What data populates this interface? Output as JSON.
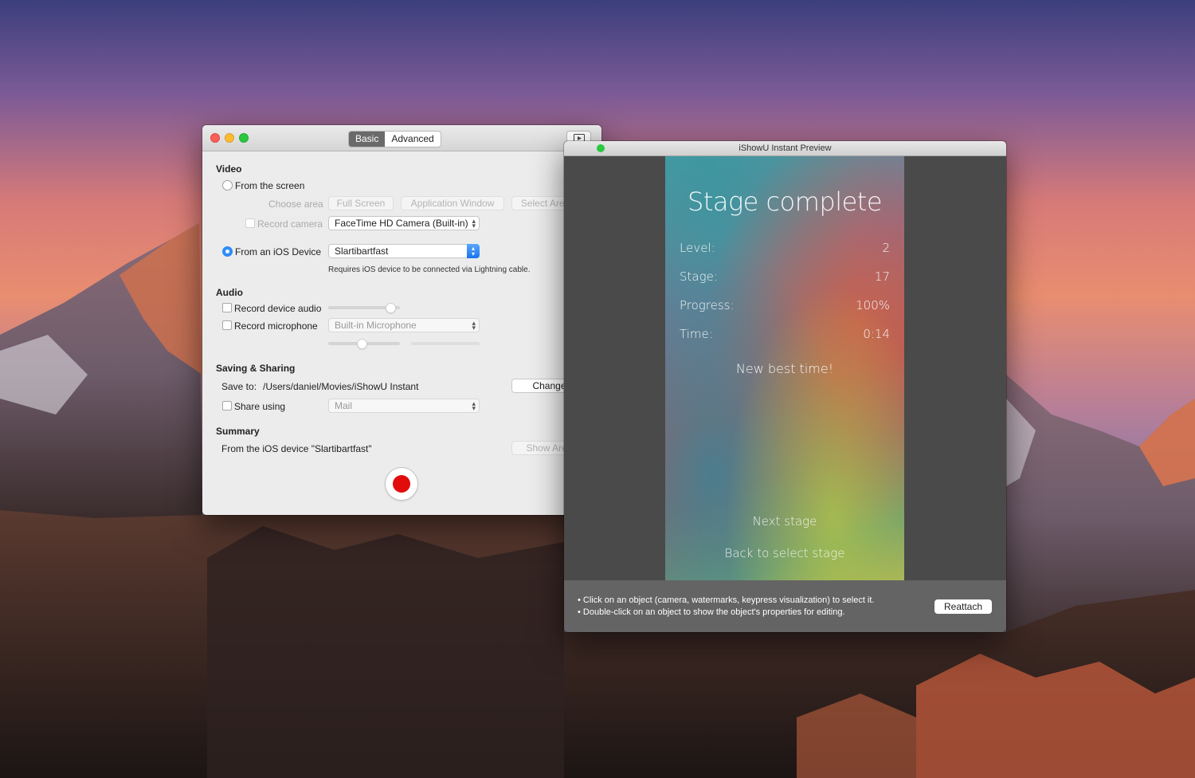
{
  "main_window": {
    "tabs": [
      {
        "label": "Basic",
        "active": true
      },
      {
        "label": "Advanced",
        "active": false
      }
    ],
    "video": {
      "section_title": "Video",
      "from_screen_label": "From the screen",
      "choose_area_label": "Choose area",
      "full_screen_label": "Full Screen",
      "application_window_label": "Application Window",
      "select_area_label": "Select Area...",
      "record_camera_label": "Record camera",
      "camera_value": "FaceTime HD Camera (Built-in)",
      "from_ios_label": "From an iOS Device",
      "ios_device_value": "Slartibartfast",
      "ios_note": "Requires iOS device to be connected via Lightning cable."
    },
    "audio": {
      "section_title": "Audio",
      "record_device_audio_label": "Record device audio",
      "device_audio_level": 0.87,
      "record_microphone_label": "Record microphone",
      "microphone_value": "Built-in Microphone",
      "microphone_level": 0.47
    },
    "saving": {
      "section_title": "Saving & Sharing",
      "save_to_label": "Save to:",
      "save_path": "/Users/daniel/Movies/iShowU Instant",
      "change_label": "Change",
      "share_using_label": "Share using",
      "share_value": "Mail"
    },
    "summary": {
      "section_title": "Summary",
      "text": "From the iOS device \"Slartibartfast\"",
      "show_area_label": "Show Area"
    }
  },
  "preview_window": {
    "title": "iShowU Instant Preview",
    "phone": {
      "heading": "Stage complete",
      "stats": [
        {
          "label": "Level:",
          "value": "2"
        },
        {
          "label": "Stage:",
          "value": "17"
        },
        {
          "label": "Progress:",
          "value": "100%"
        },
        {
          "label": "Time:",
          "value": "0:14"
        }
      ],
      "best_time": "New best time!",
      "next_stage": "Next stage",
      "back_to_select": "Back to select stage"
    },
    "tips": [
      "• Click on an object (camera, watermarks, keypress visualization) to select it.",
      "• Double-click on an object to show the object's properties for editing."
    ],
    "reattach_label": "Reattach"
  },
  "colors": {
    "accent": "#2f8cf8",
    "record": "#e20c0c"
  }
}
